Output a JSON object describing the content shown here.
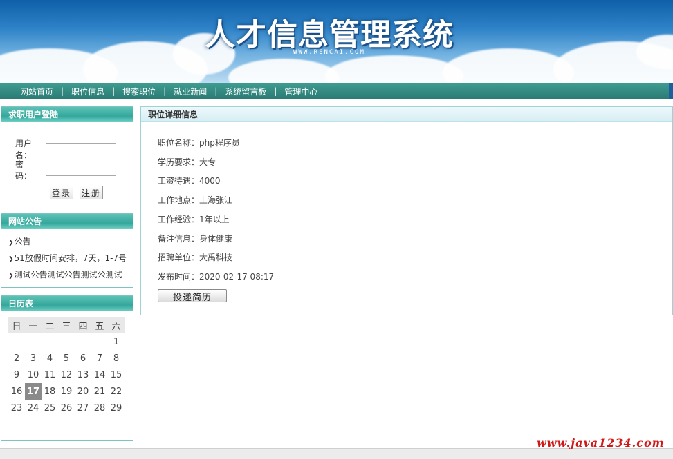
{
  "header": {
    "title": "人才信息管理系统",
    "url_text": "WWW.RENCAI.COM"
  },
  "nav": {
    "items": [
      "网站首页",
      "职位信息",
      "搜索职位",
      "就业新闻",
      "系统留言板",
      "管理中心"
    ],
    "separator": "|"
  },
  "login": {
    "title": "求职用户登陆",
    "username_label": "用户名：",
    "password_label": "密　码：",
    "login_button": "登录",
    "register_button": "注册"
  },
  "notice": {
    "title": "网站公告",
    "items": [
      "公告",
      "51放假时间安排，7天，1-7号",
      "测试公告测试公告测试公测试"
    ]
  },
  "calendar": {
    "title": "日历表",
    "weekdays": [
      "日",
      "一",
      "二",
      "三",
      "四",
      "五",
      "六"
    ],
    "weeks": [
      [
        "",
        "",
        "",
        "",
        "",
        "",
        "1"
      ],
      [
        "2",
        "3",
        "4",
        "5",
        "6",
        "7",
        "8"
      ],
      [
        "9",
        "10",
        "11",
        "12",
        "13",
        "14",
        "15"
      ],
      [
        "16",
        "17",
        "18",
        "19",
        "20",
        "21",
        "22"
      ],
      [
        "23",
        "24",
        "25",
        "26",
        "27",
        "28",
        "29"
      ]
    ],
    "today": "17"
  },
  "detail": {
    "title": "职位详细信息",
    "fields": [
      "职位名称：php程序员",
      "学历要求：大专",
      "工资待遇：4000",
      "工作地点：上海张江",
      "工作经验：1年以上",
      "备注信息：身体健康",
      "招聘单位：大禹科技",
      "发布时间：2020-02-17 08:17"
    ],
    "apply_button": "投递简历"
  },
  "watermark": "www.java1234.com",
  "colors": {
    "nav_bg": "#2f857c",
    "box_header": "#3aab9f",
    "today_bg": "#8a8a8a",
    "watermark": "#d01818"
  }
}
